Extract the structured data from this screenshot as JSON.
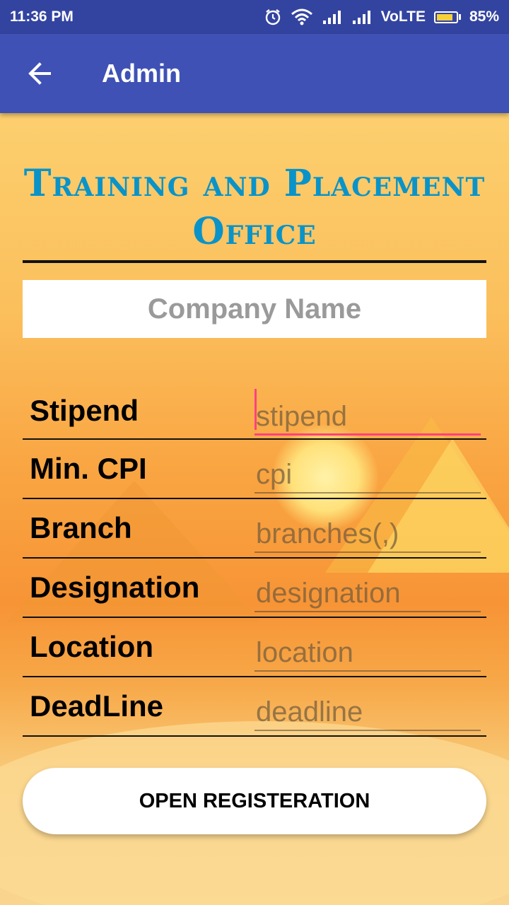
{
  "status_bar": {
    "time": "11:36 PM",
    "network_label": "VoLTE",
    "battery_percent": "85%",
    "battery_level": 0.85,
    "icons": [
      "alarm-icon",
      "wifi-icon",
      "signal-icon",
      "signal-icon",
      "battery-icon"
    ]
  },
  "app_bar": {
    "back_icon": "arrow-left-icon",
    "title": "Admin",
    "color": "#3f51b5"
  },
  "form": {
    "heading": "Training and Placement Office",
    "heading_color": "#0a93c8",
    "company_placeholder": "Company Name",
    "fields": [
      {
        "label": "Stipend",
        "placeholder": "stipend",
        "focused": true
      },
      {
        "label": "Min. CPI",
        "placeholder": "cpi"
      },
      {
        "label": "Branch",
        "placeholder": "branches(,)"
      },
      {
        "label": "Designation",
        "placeholder": "designation"
      },
      {
        "label": "Location",
        "placeholder": "location"
      },
      {
        "label": "DeadLine",
        "placeholder": "deadline"
      }
    ],
    "accent_color": "#ff4081",
    "submit_label": "OPEN REGISTERATION"
  }
}
